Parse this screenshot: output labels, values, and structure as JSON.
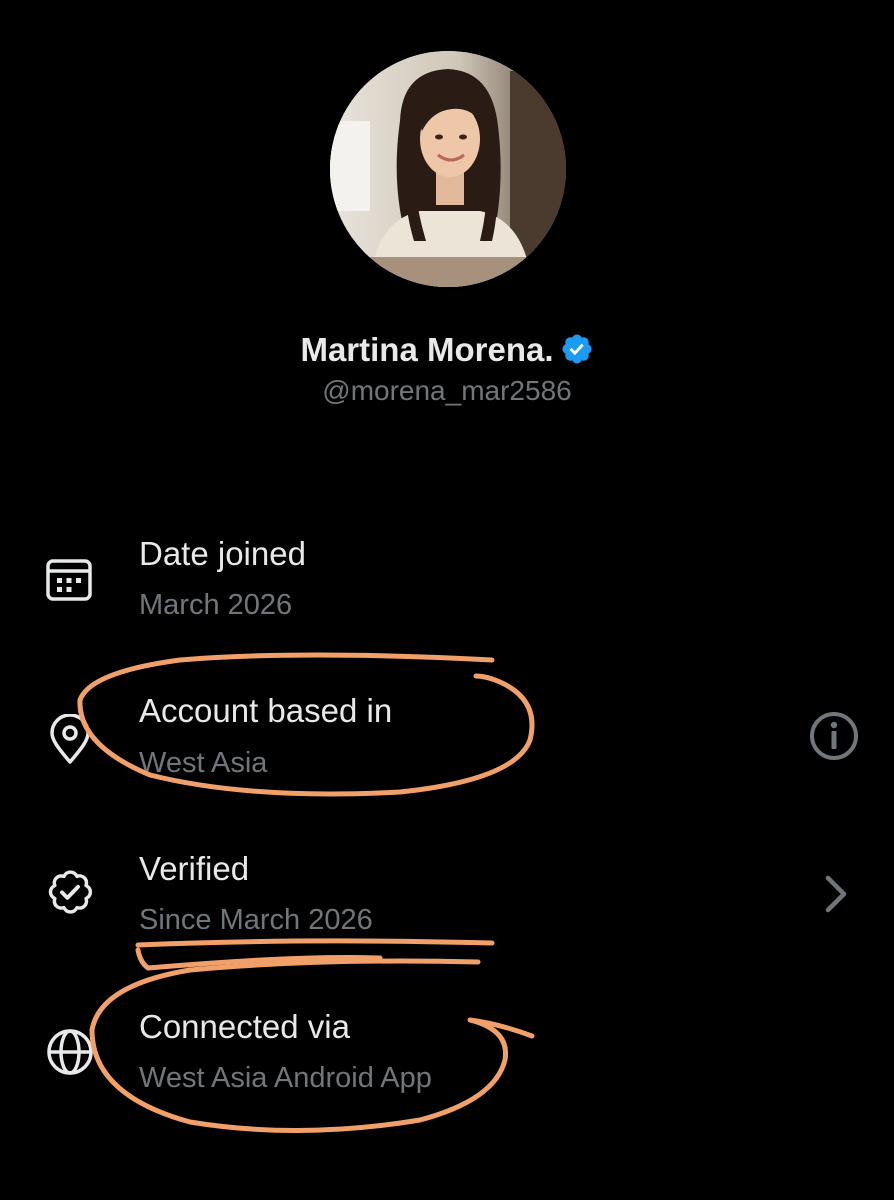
{
  "profile": {
    "name": "Martina Morena.",
    "handle": "@morena_mar2586",
    "verified_badge_icon": "verified-check-icon",
    "badge_color": "#1d9bf0"
  },
  "details": [
    {
      "icon": "calendar-icon",
      "title": "Date joined",
      "value": "March 2026"
    },
    {
      "icon": "location-pin-icon",
      "title": "Account based in",
      "value": "West Asia",
      "action_icon": "info-icon"
    },
    {
      "icon": "verified-seal-icon",
      "title": "Verified",
      "value": "Since March 2026",
      "action_icon": "chevron-right-icon"
    },
    {
      "icon": "globe-icon",
      "title": "Connected via",
      "value": "West Asia Android App"
    }
  ],
  "annotation": {
    "color": "#f0a068"
  }
}
